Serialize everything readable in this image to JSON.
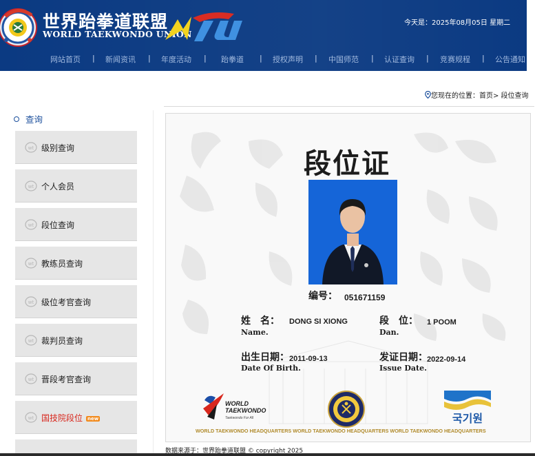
{
  "header": {
    "brand_cn": "世界跆拳道联盟",
    "brand_en": "WORLD TAEKWONDO UNION",
    "logo_text": "WTU",
    "date_text": "今天是：2025年08月05日 星期二",
    "nav": [
      {
        "label": "网站首页"
      },
      {
        "label": "新闻资讯"
      },
      {
        "label": "年度活动"
      },
      {
        "label": "跆拳道"
      },
      {
        "label": "授权声明"
      },
      {
        "label": "中国师范"
      },
      {
        "label": "认证查询"
      },
      {
        "label": "竞赛规程"
      },
      {
        "label": "公告通知"
      }
    ],
    "nav_separator": "|",
    "colors": {
      "header_bg": "#0b3a82",
      "nav_text": "#9fb8de"
    }
  },
  "breadcrumb": {
    "text": "您现在的位置：首页> 段位查询",
    "icon": "location-pin-icon"
  },
  "sidebar": {
    "title": "查询",
    "items": [
      {
        "label": "级别查询",
        "active": false
      },
      {
        "label": "个人会员",
        "active": false
      },
      {
        "label": "段位查询",
        "active": false
      },
      {
        "label": "教练员查询",
        "active": false
      },
      {
        "label": "级位考官查询",
        "active": false
      },
      {
        "label": "裁判员查询",
        "active": false
      },
      {
        "label": "晋段考官查询",
        "active": false
      },
      {
        "label": "国技院段位",
        "active": true,
        "badge": "new"
      }
    ],
    "colors": {
      "item_bg": "#e6e6e6",
      "active_text": "#d8271d",
      "title": "#1b4f9c"
    }
  },
  "certificate": {
    "title": "段位证",
    "number_label": "编号：",
    "number_value": "051671159",
    "name_label_cn": "姓　名：",
    "name_label_en": "Name.",
    "name_value": "DONG SI XIONG",
    "dan_label_cn": "段　位：",
    "dan_label_en": "Dan.",
    "dan_value": "1 POOM",
    "birth_label_cn": "出生日期：",
    "birth_label_en": "Date Of Birth.",
    "birth_value": "2011-09-13",
    "issue_label_cn": "发证日期：",
    "issue_label_en": "Issue Date.",
    "issue_value": "2022-09-14",
    "wt_logo_line1": "WORLD",
    "wt_logo_line2": "TAEKWONDO",
    "wt_logo_tagline": "Taekwondo For All",
    "kukkiwon_text": "국기원",
    "hq_band": "WORLD TAEKWONDO HEADQUARTERS WORLD TAEKWONDO HEADQUARTERS WORLD TAEKWONDO HEADQUARTERS",
    "photo_bg": "#1565d8"
  },
  "footer": {
    "source": "数据来源于：世界跆拳道联盟 © copyright 2025"
  }
}
